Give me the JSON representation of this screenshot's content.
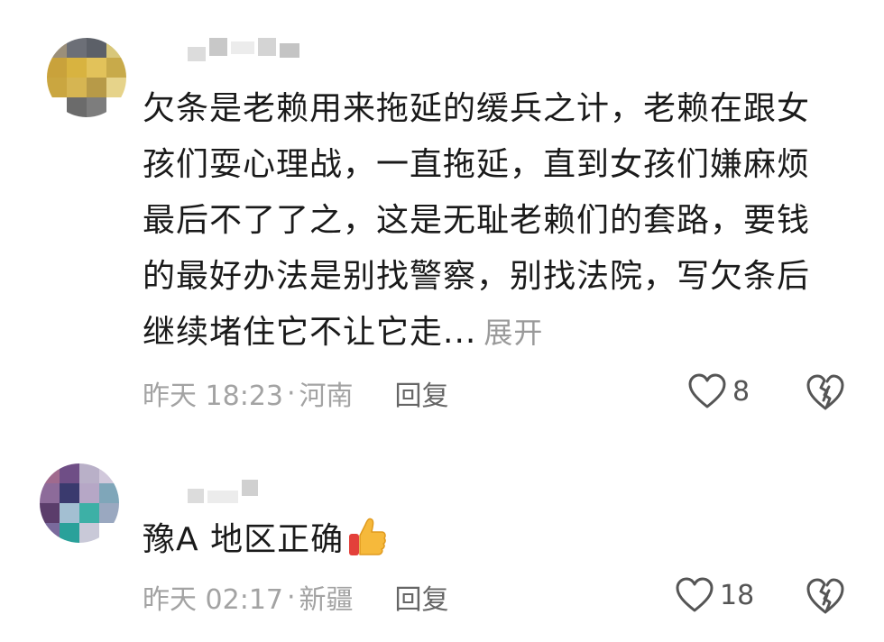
{
  "comments": [
    {
      "text_lines": [
        "欠条是老赖用来拖延的缓兵之计，老赖在跟女",
        "孩们耍心理战，一直拖延，直到女孩们嫌麻烦",
        "最后不了了之，这是无耻老赖们的套路，要钱",
        "的最好办法是别找警察，别找法院，写欠条后",
        "继续堵住它不让它走..."
      ],
      "expand_label": "展开",
      "time": "昨天 18:23",
      "separator": "·",
      "location": "河南",
      "reply_label": "回复",
      "like_count": "8",
      "icons": {
        "like": "heart-outline-icon",
        "dislike": "broken-heart-icon"
      }
    },
    {
      "text": "豫A 地区正确",
      "emoji": "thumbs-up-emoji",
      "time": "昨天 02:17",
      "separator": "·",
      "location": "新疆",
      "reply_label": "回复",
      "like_count": "18",
      "icons": {
        "like": "heart-outline-icon",
        "dislike": "broken-heart-icon"
      }
    }
  ]
}
